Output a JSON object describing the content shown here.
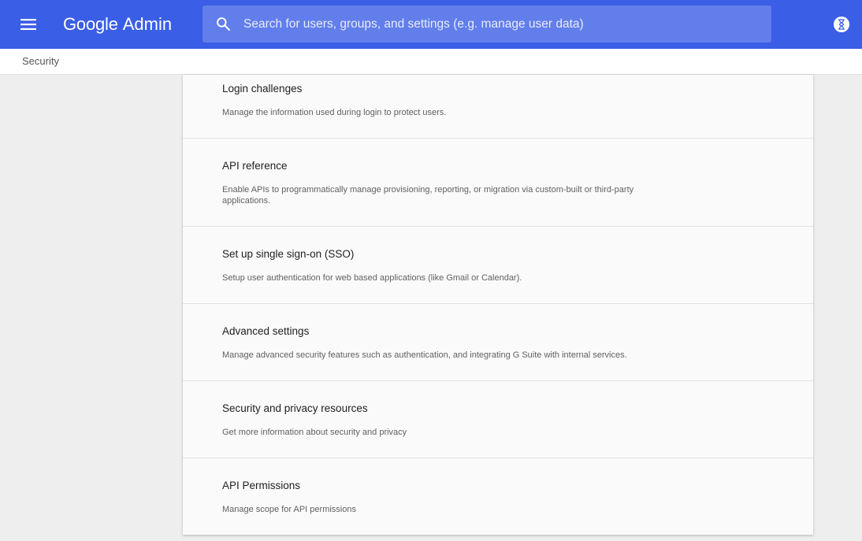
{
  "header": {
    "brand": "Google",
    "product": "Admin",
    "search_placeholder": "Search for users, groups, and settings (e.g. manage user data)",
    "icons": {
      "menu": "menu-icon",
      "search": "search-icon",
      "account": "hourglass-icon"
    },
    "colors": {
      "bar": "#3b5ee6"
    }
  },
  "breadcrumb": {
    "current": "Security"
  },
  "settings": [
    {
      "title": "Login challenges",
      "description": "Manage the information used during login to protect users."
    },
    {
      "title": "API reference",
      "description": "Enable APIs to programmatically manage provisioning, reporting, or migration via custom-built or third-party applications."
    },
    {
      "title": "Set up single sign-on (SSO)",
      "description": "Setup user authentication for web based applications (like Gmail or Calendar)."
    },
    {
      "title": "Advanced settings",
      "description": "Manage advanced security features such as authentication, and integrating G Suite with internal services."
    },
    {
      "title": "Security and privacy resources",
      "description": "Get more information about security and privacy"
    },
    {
      "title": "API Permissions",
      "description": "Manage scope for API permissions"
    }
  ]
}
